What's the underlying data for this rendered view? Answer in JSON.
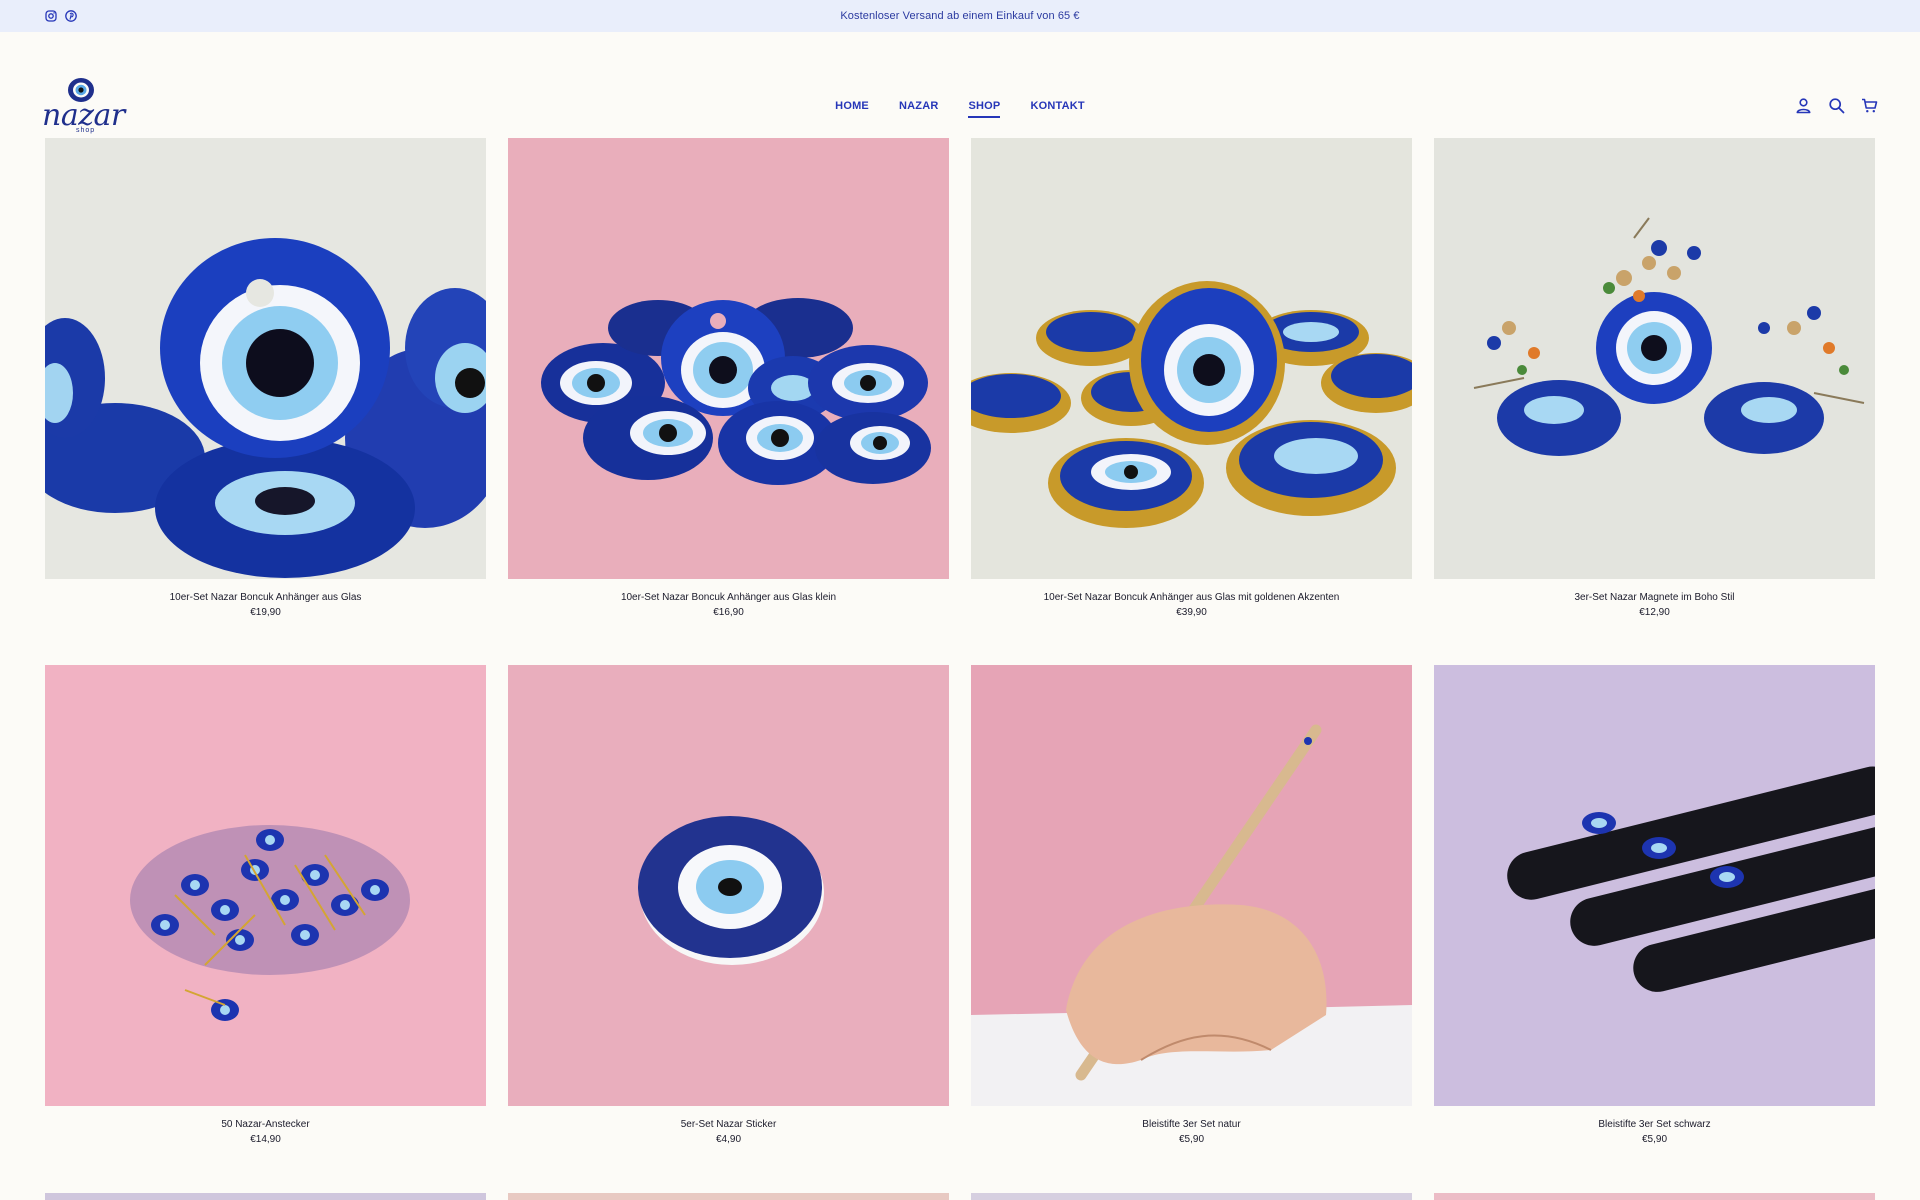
{
  "announcement": {
    "text": "Kostenloser Versand ab einem Einkauf von 65 €"
  },
  "social": {
    "icons": [
      "instagram-icon",
      "pinterest-icon"
    ]
  },
  "brand": {
    "name": "nazar",
    "sub": "shop",
    "color": "#1f2f8c"
  },
  "nav": {
    "items": [
      {
        "label": "HOME"
      },
      {
        "label": "NAZAR"
      },
      {
        "label": "SHOP",
        "active": true
      },
      {
        "label": "KONTAKT"
      }
    ]
  },
  "header_icons": [
    "account-icon",
    "search-icon",
    "cart-icon"
  ],
  "products": [
    {
      "title": "10er-Set Nazar Boncuk Anhänger aus Glas",
      "price": "€19,90",
      "bg": "#e6e7e1"
    },
    {
      "title": "10er-Set Nazar Boncuk Anhänger aus Glas klein",
      "price": "€16,90",
      "bg": "#e9aebb"
    },
    {
      "title": "10er-Set Nazar Boncuk Anhänger aus Glas mit goldenen Akzenten",
      "price": "€39,90",
      "bg": "#e4e5dd"
    },
    {
      "title": "3er-Set Nazar Magnete im Boho Stil",
      "price": "€12,90",
      "bg": "#e3e4de"
    },
    {
      "title": "50 Nazar-Anstecker",
      "price": "€14,90",
      "bg": "#f1b2c3"
    },
    {
      "title": "5er-Set Nazar Sticker",
      "price": "€4,90",
      "bg": "#e9aebd"
    },
    {
      "title": "Bleistifte 3er Set natur",
      "price": "€5,90",
      "bg": "#e6a4b6"
    },
    {
      "title": "Bleistifte 3er Set schwarz",
      "price": "€5,90",
      "bg": "#ccbedf"
    }
  ],
  "colors": {
    "accent": "#2636b8",
    "announce_bg": "#e9eefb",
    "page_bg": "#fcfbf7"
  }
}
